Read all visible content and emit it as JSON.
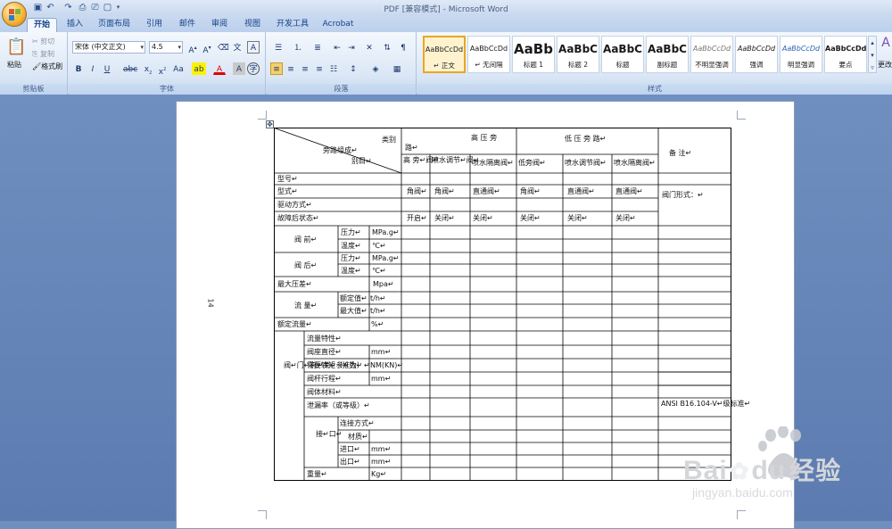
{
  "window": {
    "title": "PDF [兼容模式] - Microsoft Word"
  },
  "tabs": [
    "开始",
    "插入",
    "页面布局",
    "引用",
    "邮件",
    "审阅",
    "视图",
    "开发工具",
    "Acrobat"
  ],
  "clipboard": {
    "paste": "粘贴",
    "cut": "剪切",
    "copy": "复制",
    "format_painter": "格式刷",
    "group": "剪贴板"
  },
  "font": {
    "name": "宋体 (中文正文)",
    "size": "4.5",
    "group": "字体"
  },
  "paragraph": {
    "group": "段落"
  },
  "styles": {
    "group": "样式",
    "change": "更改",
    "items": [
      {
        "sample": "AaBbCcDd",
        "name": "↵ 正文"
      },
      {
        "sample": "AaBbCcDd",
        "name": "↵ 无间隔"
      },
      {
        "sample": "AaBb",
        "name": "标题 1"
      },
      {
        "sample": "AaBbC",
        "name": "标题 2"
      },
      {
        "sample": "AaBbC",
        "name": "标题"
      },
      {
        "sample": "AaBbC",
        "name": "副标题"
      },
      {
        "sample": "AaBbCcDd",
        "name": "不明显强调"
      },
      {
        "sample": "AaBbCcDd",
        "name": "强调"
      },
      {
        "sample": "AaBbCcDd",
        "name": "明显强调"
      },
      {
        "sample": "AaBbCcDd",
        "name": "要点"
      }
    ]
  },
  "document": {
    "page_number": "14",
    "table": {
      "corner_top": "类别",
      "corner_mid": "旁路组成↵",
      "corner_bottom": "别目↵",
      "hp_header": "高  压  旁",
      "hp_header2": "路↵",
      "lp_header": "低  压  旁  路↵",
      "remarks_header": "备        注↵",
      "sub_headers": [
        "高  旁↵阀↵",
        "喷水调节↵阀↵",
        "喷水隔离阀↵",
        "低旁阀↵",
        "喷水调节阀↵",
        "喷水隔离阀↵"
      ],
      "rows": {
        "model": "型号↵",
        "type": "型式↵",
        "type_values": [
          "角阀↵",
          "角阀↵",
          "直通阀↵",
          "角阀↵",
          "直通阀↵",
          "直通阀↵"
        ],
        "drive": "驱动方式↵",
        "fail": "故障后状态↵",
        "fail_values": [
          "开启↵",
          "关闭↵",
          "关闭↵",
          "关闭↵",
          "关闭↵",
          "关闭↵"
        ],
        "before_valve": "阀  前↵",
        "after_valve": "阀  后↵",
        "pressure": "压力↵",
        "temperature": "温度↵",
        "unit_mpag": "MPa.g↵",
        "unit_c": "℃↵",
        "max_dp": "最大压差↵",
        "unit_mpa": "Mpa↵",
        "flow": "流  量↵",
        "rated": "额定值↵",
        "max": "最大值↵",
        "unit_th": "t/h↵",
        "rated_flow": "额定流量↵",
        "unit_pct": "%↵",
        "valve_params": "阀↵门↵有↵关↵参↵数↵",
        "flow_char": "流量特性↵",
        "seat_dia": "阀座直径↵",
        "unit_mm": "mm↵",
        "torque": "需要转矩（推力）↵",
        "unit_nm": "NM(KN)↵",
        "stroke": "阀杆行程↵",
        "body_mat": "阀体材料↵",
        "leakage": "泄漏率（或等级）↵",
        "leakage_remark": "ANSI  B16.104-V↵级标准↵",
        "connection": "接↵口↵",
        "conn_type": "连接方式↵",
        "material": "材质↵",
        "inlet": "进口↵",
        "outlet": "出口↵",
        "weight": "重量↵",
        "unit_kg": "Kg↵",
        "valve_form": "阀门形式：↵"
      }
    }
  },
  "watermark": {
    "brand": "Bai",
    "brand2": "du",
    "cn": "经验",
    "url": "jingyan.baidu.com"
  },
  "colors": {
    "accent": "#15428b",
    "ribbon": "#dbe7f6",
    "doc_bg": "#6f8fc0",
    "highlight": "#e9a623"
  }
}
